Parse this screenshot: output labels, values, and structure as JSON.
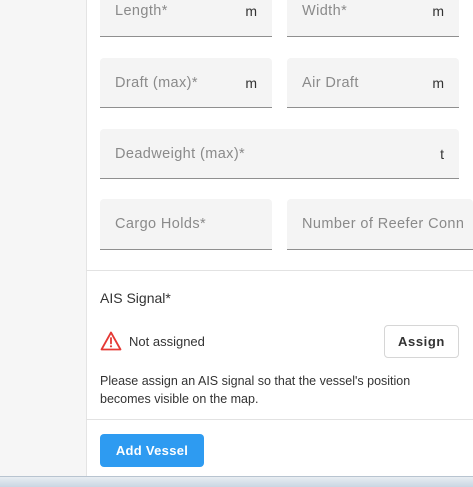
{
  "form": {
    "length": {
      "label": "Length*",
      "unit": "m"
    },
    "width": {
      "label": "Width*",
      "unit": "m"
    },
    "draft": {
      "label": "Draft (max)*",
      "unit": "m"
    },
    "air_draft": {
      "label": "Air Draft",
      "unit": "m"
    },
    "deadweight": {
      "label": "Deadweight (max)*",
      "unit": "t"
    },
    "cargo_holds": {
      "label": "Cargo Holds*"
    },
    "reefer": {
      "label": "Number of Reefer Conn"
    }
  },
  "ais": {
    "title": "AIS Signal*",
    "status": "Not assigned",
    "assign_label": "Assign",
    "help": "Please assign an AIS signal so that the vessel's position becomes visible on the map."
  },
  "actions": {
    "add_vessel_label": "Add Vessel"
  },
  "colors": {
    "primary": "#2e9bf1",
    "warning": "#e53935"
  },
  "icons": {
    "warning": "warning-icon"
  }
}
